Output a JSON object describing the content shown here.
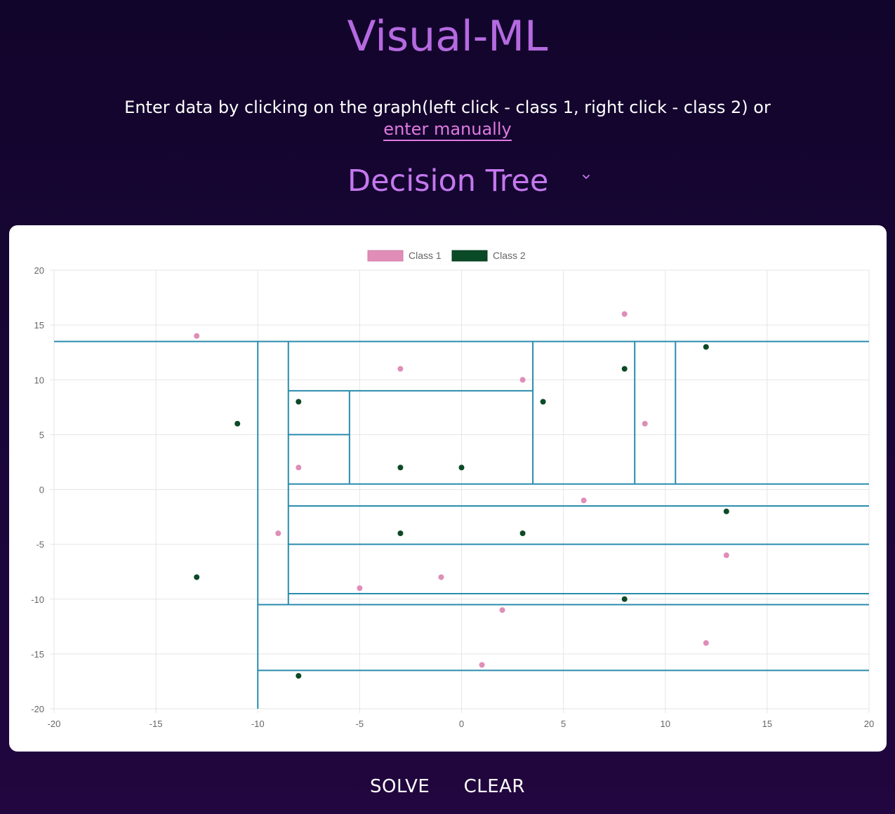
{
  "app": {
    "title": "Visual-ML"
  },
  "instructions": {
    "text": "Enter data by clicking on the graph(left click - class 1, right click - class 2) or",
    "link_text": "enter manually"
  },
  "algorithm_select": {
    "selected": "Decision Tree",
    "icon": "chevron-down-icon"
  },
  "buttons": {
    "solve_label": "SOLVE",
    "clear_label": "CLEAR"
  },
  "colors": {
    "class1": "#e08db8",
    "class2": "#0b4a26",
    "boundary": "#2a8cae",
    "title": "#b56ae0",
    "link": "#e07adf"
  },
  "chart_data": {
    "type": "scatter",
    "xlim": [
      -20,
      20
    ],
    "ylim": [
      -20,
      20
    ],
    "xticks": [
      -20,
      -15,
      -10,
      -5,
      0,
      5,
      10,
      15,
      20
    ],
    "yticks": [
      20,
      15,
      10,
      5,
      0,
      -5,
      -10,
      -15,
      -20
    ],
    "grid": true,
    "legend_position": "top-center",
    "series": [
      {
        "name": "Class 1",
        "points": [
          [
            -13,
            14
          ],
          [
            -3,
            11
          ],
          [
            3,
            10
          ],
          [
            8,
            16
          ],
          [
            9,
            6
          ],
          [
            -8,
            2
          ],
          [
            6,
            -1
          ],
          [
            -9,
            -4
          ],
          [
            13,
            -6
          ],
          [
            -5,
            -9
          ],
          [
            -1,
            -8
          ],
          [
            2,
            -11
          ],
          [
            12,
            -14
          ],
          [
            1,
            -16
          ]
        ]
      },
      {
        "name": "Class 2",
        "points": [
          [
            -11,
            6
          ],
          [
            -8,
            8
          ],
          [
            4,
            8
          ],
          [
            8,
            11
          ],
          [
            12,
            13
          ],
          [
            -3,
            2
          ],
          [
            0,
            2
          ],
          [
            13,
            -2
          ],
          [
            -3,
            -4
          ],
          [
            3,
            -4
          ],
          [
            -13,
            -8
          ],
          [
            8,
            -10
          ],
          [
            -8,
            -17
          ]
        ]
      }
    ],
    "decision_boundaries": [
      {
        "orient": "h",
        "y": 13.5,
        "x1": -20,
        "x2": 20
      },
      {
        "orient": "v",
        "x": -10,
        "y1": -20,
        "y2": 13.5
      },
      {
        "orient": "v",
        "x": -8.5,
        "y1": -10.5,
        "y2": 13.5
      },
      {
        "orient": "h",
        "y": 9,
        "x1": -8.5,
        "x2": 3.5
      },
      {
        "orient": "v",
        "x": -5.5,
        "y1": 0.5,
        "y2": 9
      },
      {
        "orient": "h",
        "y": 5,
        "x1": -8.5,
        "x2": -5.5
      },
      {
        "orient": "v",
        "x": 3.5,
        "y1": 0.5,
        "y2": 13.5
      },
      {
        "orient": "v",
        "x": 8.5,
        "y1": 0.5,
        "y2": 13.5
      },
      {
        "orient": "v",
        "x": 10.5,
        "y1": 0.5,
        "y2": 13.5
      },
      {
        "orient": "h",
        "y": 0.5,
        "x1": -8.5,
        "x2": 20
      },
      {
        "orient": "h",
        "y": -1.5,
        "x1": -8.5,
        "x2": 20
      },
      {
        "orient": "h",
        "y": -5,
        "x1": -8.5,
        "x2": 20
      },
      {
        "orient": "h",
        "y": -9.5,
        "x1": -8.5,
        "x2": 20
      },
      {
        "orient": "h",
        "y": -10.5,
        "x1": -10,
        "x2": 20
      },
      {
        "orient": "h",
        "y": -16.5,
        "x1": -10,
        "x2": 20
      }
    ]
  }
}
